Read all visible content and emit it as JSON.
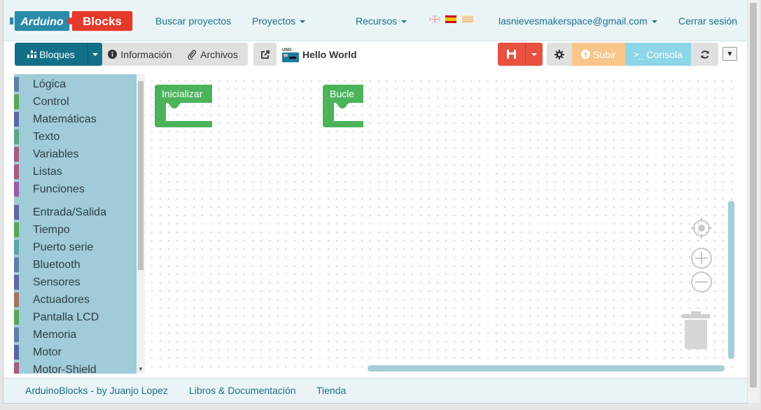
{
  "navbar": {
    "logo_left": "Arduino",
    "logo_right": "Blocks",
    "search_projects": "Buscar proyectos",
    "projects": "Proyectos",
    "resources": "Recursos",
    "user_email": "lasnievesmakerspace@gmail.com",
    "logout": "Cerrar sesión",
    "languages": [
      "en-flag-icon",
      "es-flag-icon",
      "ca-flag-icon"
    ]
  },
  "toolbar": {
    "blocks": "Bloques",
    "info": "Información",
    "files": "Archivos",
    "board_label": "UNO",
    "project_title": "Hello World",
    "upload": "Subir",
    "console": "Consola"
  },
  "sidebar": {
    "items": [
      {
        "label": "Lógica",
        "color": "#5b80a5"
      },
      {
        "label": "Control",
        "color": "#5ba55b"
      },
      {
        "label": "Matemáticas",
        "color": "#5b67a5"
      },
      {
        "label": "Texto",
        "color": "#5ba58c"
      },
      {
        "label": "Variables",
        "color": "#a55b80"
      },
      {
        "label": "Listas",
        "color": "#a55b80"
      },
      {
        "label": "Funciones",
        "color": "#995ba5"
      },
      {
        "label": "Entrada/Salida",
        "color": "#5b67a5"
      },
      {
        "label": "Tiempo",
        "color": "#5ba55b"
      },
      {
        "label": "Puerto serie",
        "color": "#5ba5a5"
      },
      {
        "label": "Bluetooth",
        "color": "#5b80a5"
      },
      {
        "label": "Sensores",
        "color": "#5b67a5"
      },
      {
        "label": "Actuadores",
        "color": "#a5745b"
      },
      {
        "label": "Pantalla LCD",
        "color": "#5ba55b"
      },
      {
        "label": "Memoria",
        "color": "#5b80a5"
      },
      {
        "label": "Motor",
        "color": "#5b67a5"
      },
      {
        "label": "Motor-Shield",
        "color": "#a55b80"
      }
    ]
  },
  "workspace": {
    "blocks": [
      {
        "label": "Inicializar",
        "color": "#4cb35a"
      },
      {
        "label": "Bucle",
        "color": "#4cb35a"
      }
    ]
  },
  "footer": {
    "credit": "ArduinoBlocks - by Juanjo Lopez",
    "docs": "Libros & Documentación",
    "store": "Tienda"
  },
  "colors": {
    "primary": "#136f87",
    "save": "#e8513f",
    "upload": "#f8c68a",
    "console": "#8dd6e8",
    "sidebar_bg": "#a0cbd8"
  }
}
